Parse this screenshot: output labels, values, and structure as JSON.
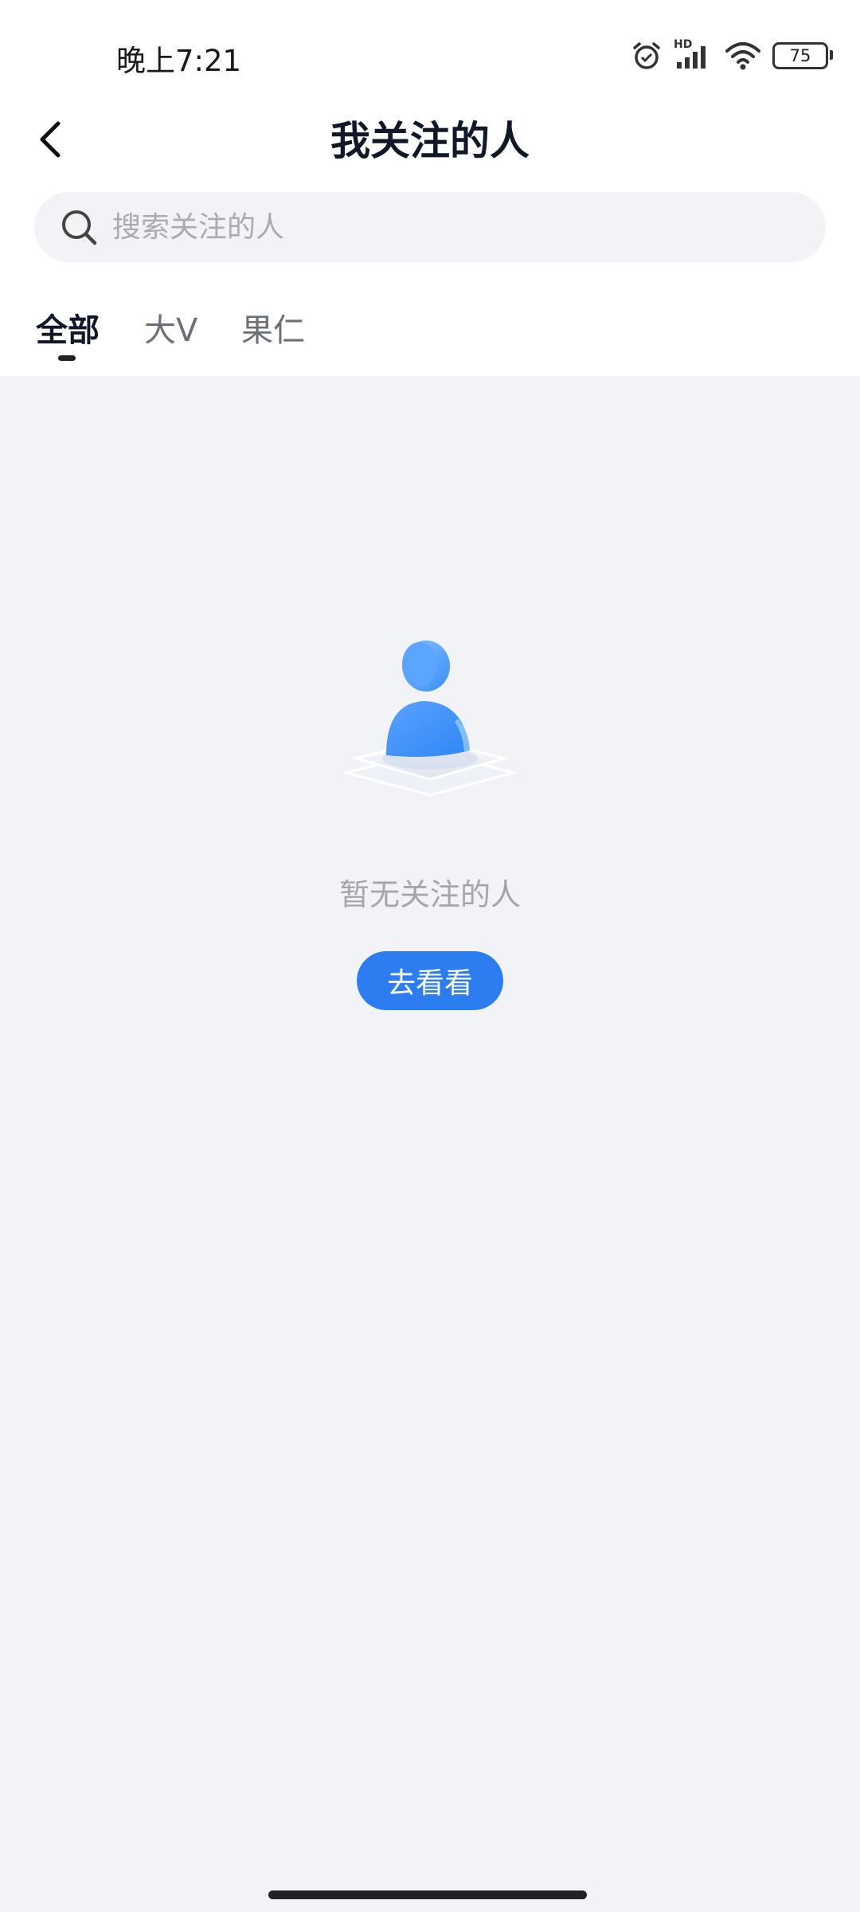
{
  "status_bar": {
    "time": "晚上7:21",
    "network": "HD",
    "battery": "75",
    "icons": [
      "alarm-icon",
      "signal-icon",
      "wifi-icon",
      "battery-icon"
    ]
  },
  "header": {
    "title": "我关注的人",
    "back_icon": "chevron-left-icon"
  },
  "search": {
    "placeholder": "搜索关注的人",
    "value": ""
  },
  "tabs": [
    {
      "label": "全部",
      "active": true
    },
    {
      "label": "大V",
      "active": false
    },
    {
      "label": "果仁",
      "active": false
    }
  ],
  "empty_state": {
    "illustration": "person-placeholder-icon",
    "message": "暂无关注的人",
    "button_label": "去看看"
  },
  "colors": {
    "accent": "#2c7ef0",
    "background": "#f2f3f7",
    "title_text": "#111827",
    "muted_text": "#a3a6ae"
  }
}
